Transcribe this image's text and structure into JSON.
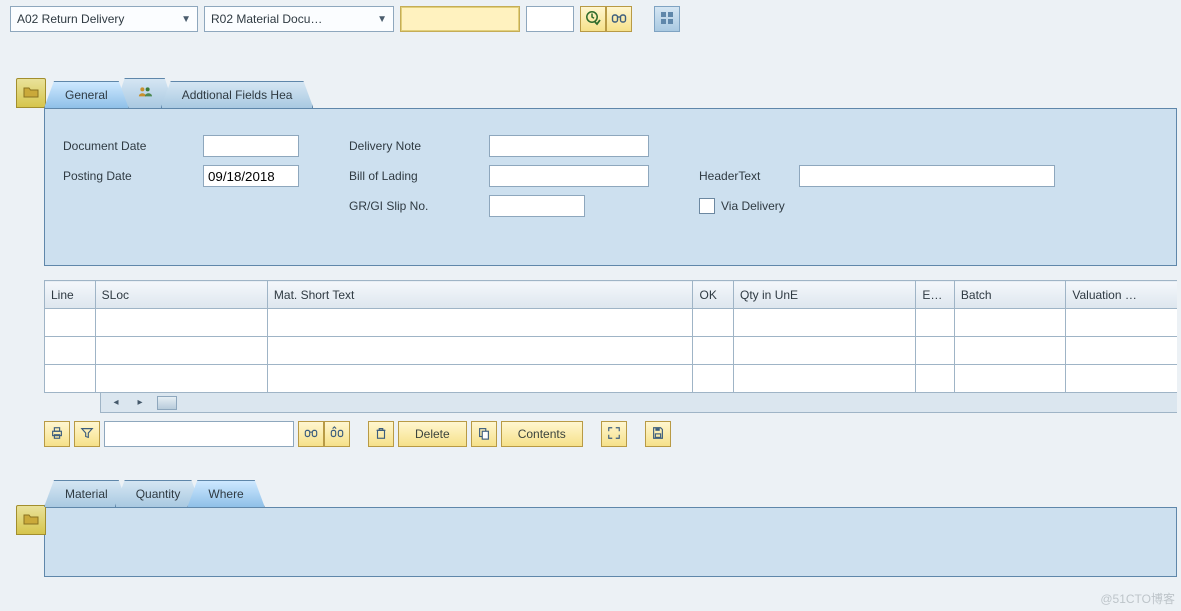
{
  "top": {
    "dd1": "A02 Return Delivery",
    "dd2": "R02 Material Docu…",
    "input1": "",
    "input2": ""
  },
  "tabs_header": {
    "general": "General",
    "additional": "Addtional Fields Hea"
  },
  "header_fields": {
    "doc_date_lbl": "Document Date",
    "doc_date_val": "",
    "posting_date_lbl": "Posting Date",
    "posting_date_val": "09/18/2018",
    "delivery_note_lbl": "Delivery Note",
    "delivery_note_val": "",
    "bol_lbl": "Bill of Lading",
    "bol_val": "",
    "slip_lbl": "GR/GI Slip No.",
    "slip_val": "",
    "header_text_lbl": "HeaderText",
    "header_text_val": "",
    "via_delivery_lbl": "Via Delivery"
  },
  "grid": {
    "cols": {
      "line": "Line",
      "sloc": "SLoc",
      "mat_short": "Mat. Short Text",
      "ok": "OK",
      "qty": "Qty in UnE",
      "e": "E…",
      "batch": "Batch",
      "valuation": "Valuation …"
    }
  },
  "bottom_toolbar": {
    "search_val": "",
    "delete_lbl": "Delete",
    "contents_lbl": "Contents"
  },
  "tabs_item": {
    "material": "Material",
    "quantity": "Quantity",
    "where": "Where"
  },
  "watermark": "@51CTO博客"
}
